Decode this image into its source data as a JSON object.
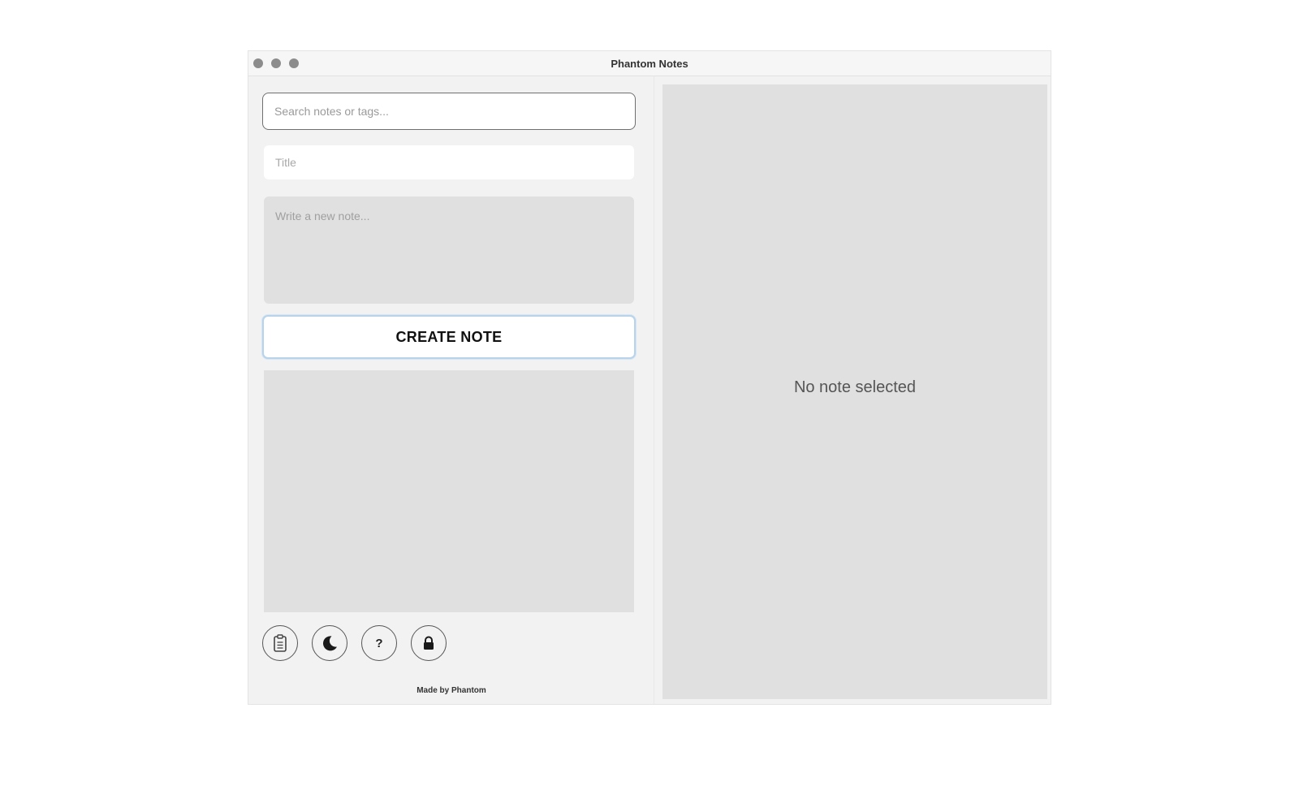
{
  "window": {
    "title": "Phantom Notes"
  },
  "sidebar": {
    "search_placeholder": "Search notes or tags...",
    "title_placeholder": "Title",
    "note_placeholder": "Write a new note...",
    "create_button_label": "CREATE NOTE",
    "toolbar": [
      {
        "name": "clipboard-icon"
      },
      {
        "name": "moon-icon"
      },
      {
        "name": "help-icon",
        "glyph": "?"
      },
      {
        "name": "lock-icon"
      }
    ],
    "footer": "Made by Phantom"
  },
  "detail": {
    "empty_message": "No note selected"
  }
}
